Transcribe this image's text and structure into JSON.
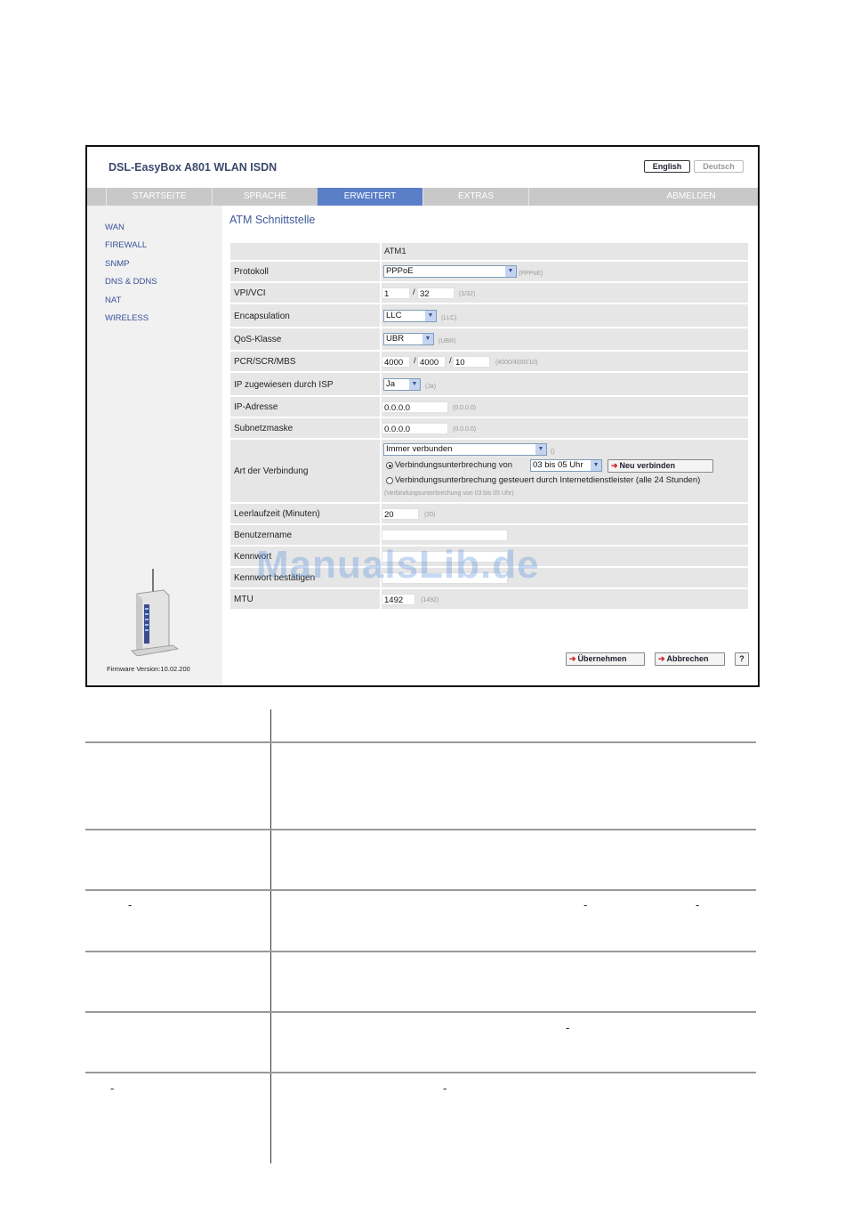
{
  "header": {
    "app_title": "DSL-EasyBox A801 WLAN ISDN",
    "lang_english": "English",
    "lang_deutsch": "Deutsch"
  },
  "nav": {
    "items": [
      "STARTSEITE",
      "SPRACHE",
      "ERWEITERT",
      "EXTRAS",
      "ABMELDEN"
    ],
    "active": "ERWEITERT"
  },
  "sidebar": {
    "items": [
      "WAN",
      "FIREWALL",
      "SNMP",
      "DNS & DDNS",
      "NAT",
      "WIRELESS"
    ],
    "firmware": "Firmware Version:10.02.200"
  },
  "page": {
    "title": "ATM Schnittstelle",
    "column_header": "ATM1"
  },
  "form": {
    "protokoll": {
      "label": "Protokoll",
      "value": "PPPoE",
      "hint": "(PPPoE)"
    },
    "vpi_vci": {
      "label": "VPI/VCI",
      "vpi": "1",
      "vci": "32",
      "hint": "(1/32)"
    },
    "encapsulation": {
      "label": "Encapsulation",
      "value": "LLC",
      "hint": "(LLC)"
    },
    "qos": {
      "label": "QoS-Klasse",
      "value": "UBR",
      "hint": "(UBR)"
    },
    "pcr": {
      "label": "PCR/SCR/MBS",
      "pcr": "4000",
      "scr": "4000",
      "mbs": "10",
      "hint": "(4000/4000/10)"
    },
    "ip_isp": {
      "label": "IP zugewiesen durch ISP",
      "value": "Ja",
      "hint": "(Ja)"
    },
    "ip_addr": {
      "label": "IP-Adresse",
      "value": "0.0.0.0",
      "hint": "(0.0.0.0)"
    },
    "subnet": {
      "label": "Subnetzmaske",
      "value": "0.0.0.0",
      "hint": "(0.0.0.0)"
    },
    "verbindung": {
      "label": "Art der Verbindung",
      "value": "Immer verbunden",
      "hint": "()",
      "option1": "Verbindungsunterbrechung von",
      "option1_select": "03 bis 05 Uhr",
      "reconnect_button": "Neu verbinden",
      "option2": "Verbindungsunterbrechung gesteuert durch Internetdienstleister (alle 24 Stunden)",
      "note": "(Verbindungsunterbrechung von 03 bis 05 Uhr)"
    },
    "leerlauf": {
      "label": "Leerlaufzeit (Minuten)",
      "value": "20",
      "hint": "(20)"
    },
    "benutzer": {
      "label": "Benutzername",
      "value": ""
    },
    "kennwort": {
      "label": "Kennwort",
      "value": ""
    },
    "kennwort2": {
      "label": "Kennwort bestätigen",
      "value": ""
    },
    "mtu": {
      "label": "MTU",
      "value": "1492",
      "hint": "(1492)"
    }
  },
  "buttons": {
    "apply": "Übernehmen",
    "cancel": "Abbrechen",
    "help": "?"
  },
  "watermark": "ManualsLib.de",
  "icons": {
    "arrow": "red-arrow-icon",
    "dropdown": "chevron-down-icon"
  }
}
